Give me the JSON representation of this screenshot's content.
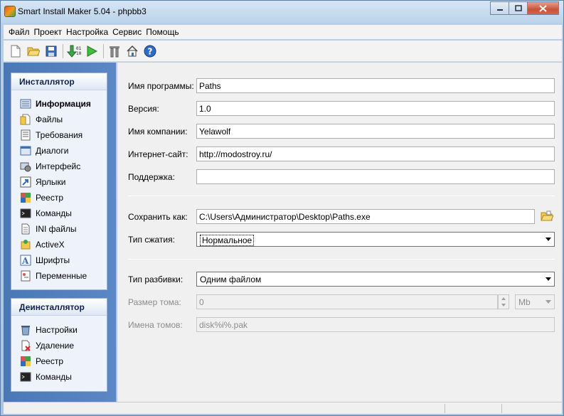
{
  "window": {
    "title": "Smart Install Maker 5.04 - phpbb3",
    "min_label": "▁",
    "max_label": "□",
    "close_label": "✕"
  },
  "menu": [
    "Файл",
    "Проект",
    "Настройка",
    "Сервис",
    "Помощь"
  ],
  "toolbar_icons": [
    "new-file-icon",
    "open-folder-icon",
    "save-icon",
    "compile-icon",
    "run-icon",
    "tools-icon",
    "home-icon",
    "help-icon"
  ],
  "installer": {
    "title": "Инсталлятор",
    "items": [
      {
        "label": "Информация",
        "icon": "info-icon"
      },
      {
        "label": "Файлы",
        "icon": "files-icon"
      },
      {
        "label": "Требования",
        "icon": "requirements-icon"
      },
      {
        "label": "Диалоги",
        "icon": "dialogs-icon"
      },
      {
        "label": "Интерфейс",
        "icon": "interface-icon"
      },
      {
        "label": "Ярлыки",
        "icon": "shortcuts-icon"
      },
      {
        "label": "Реестр",
        "icon": "registry-icon"
      },
      {
        "label": "Команды",
        "icon": "commands-icon"
      },
      {
        "label": "INI файлы",
        "icon": "ini-icon"
      },
      {
        "label": "ActiveX",
        "icon": "activex-icon"
      },
      {
        "label": "Шрифты",
        "icon": "fonts-icon"
      },
      {
        "label": "Переменные",
        "icon": "variables-icon"
      }
    ]
  },
  "uninstaller": {
    "title": "Деинсталлятор",
    "items": [
      {
        "label": "Настройки",
        "icon": "settings-icon"
      },
      {
        "label": "Удаление",
        "icon": "delete-icon"
      },
      {
        "label": "Реестр",
        "icon": "registry-icon"
      },
      {
        "label": "Команды",
        "icon": "commands-icon"
      }
    ]
  },
  "form": {
    "program_name": {
      "label": "Имя программы:",
      "value": "Paths"
    },
    "version": {
      "label": "Версия:",
      "value": "1.0"
    },
    "company": {
      "label": "Имя компании:",
      "value": "Yelawolf"
    },
    "website": {
      "label": "Интернет-сайт:",
      "value": "http://modostroy.ru/"
    },
    "support": {
      "label": "Поддержка:",
      "value": ""
    },
    "save_as": {
      "label": "Сохранить как:",
      "value": "C:\\Users\\Администратор\\Desktop\\Paths.exe"
    },
    "compression": {
      "label": "Тип сжатия:",
      "value": "Нормальное"
    },
    "split_type": {
      "label": "Тип разбивки:",
      "value": "Одним файлом"
    },
    "volume_size": {
      "label": "Размер тома:",
      "value": "0",
      "unit": "Mb"
    },
    "volume_names": {
      "label": "Имена томов:",
      "value": "disk%i%.pak"
    }
  },
  "colors": {
    "accent": "#4a78b6",
    "panel": "#eef3fb",
    "close": "#c9533a"
  }
}
